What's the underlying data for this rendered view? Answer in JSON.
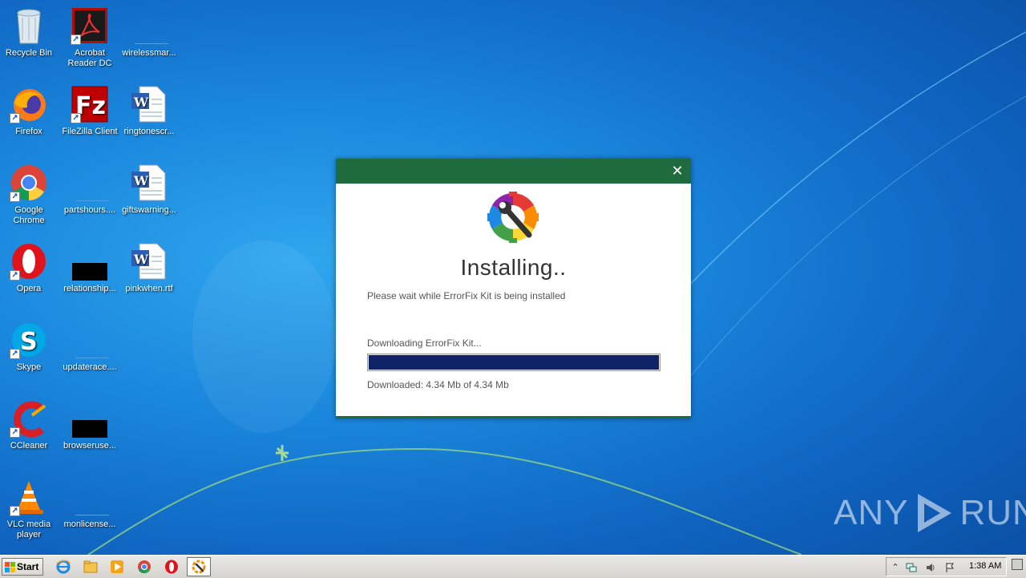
{
  "desktop": {
    "icons": [
      {
        "label": "Recycle Bin",
        "icon": "recycle-bin-icon"
      },
      {
        "label": "Acrobat Reader DC",
        "icon": "acrobat-icon"
      },
      {
        "label": "wirelessmar...",
        "icon": "blank-file-icon"
      },
      {
        "label": "Firefox",
        "icon": "firefox-icon"
      },
      {
        "label": "FileZilla Client",
        "icon": "filezilla-icon"
      },
      {
        "label": "ringtonescr...",
        "icon": "word-doc-icon"
      },
      {
        "label": "Google Chrome",
        "icon": "chrome-icon"
      },
      {
        "label": "partshours....",
        "icon": "blank-file-icon"
      },
      {
        "label": "giftswarning...",
        "icon": "word-doc-icon"
      },
      {
        "label": "Opera",
        "icon": "opera-icon"
      },
      {
        "label": "relationship...",
        "icon": "black-file-icon"
      },
      {
        "label": "pinkwhen.rtf",
        "icon": "word-doc-icon"
      },
      {
        "label": "Skype",
        "icon": "skype-icon"
      },
      {
        "label": "updaterace....",
        "icon": "blank-file-icon"
      },
      {
        "label": "CCleaner",
        "icon": "ccleaner-icon"
      },
      {
        "label": "browseruse...",
        "icon": "black-file-icon"
      },
      {
        "label": "VLC media player",
        "icon": "vlc-icon"
      },
      {
        "label": "monlicense...",
        "icon": "blank-file-icon"
      }
    ]
  },
  "installer": {
    "close_glyph": "✕",
    "heading": "Installing..",
    "subtitle": "Please wait while ErrorFix Kit is being installed",
    "status": "Downloading ErrorFix Kit...",
    "downloaded": "Downloaded: 4.34 Mb of 4.34 Mb",
    "progress_fraction": 1.0,
    "title_color": "#1f6b3d",
    "progress_color": "#0f2266"
  },
  "watermark": {
    "left": "ANY",
    "right": "RUN"
  },
  "taskbar": {
    "start_label": "Start",
    "clock": "1:38 AM",
    "pinned": [
      "ie-icon",
      "explorer-icon",
      "media-player-icon",
      "chrome-icon",
      "opera-icon",
      "errorfix-icon"
    ]
  }
}
